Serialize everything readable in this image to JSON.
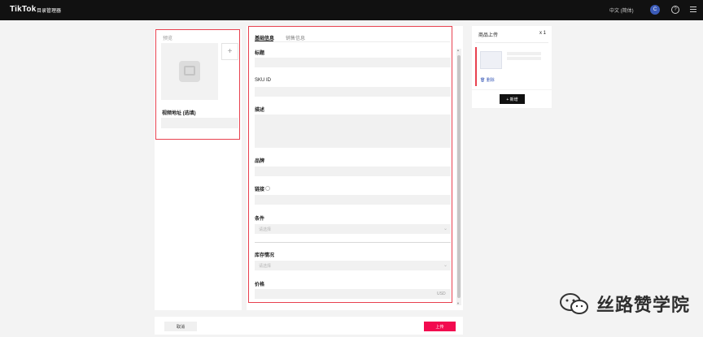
{
  "topbar": {
    "logo": "TikTok",
    "logo_sub": "目录管理器",
    "language": "中文 (简体)",
    "avatar_initial": "C"
  },
  "preview": {
    "title": "预览",
    "add_symbol": "+",
    "video_label": "视频地址 (选填)"
  },
  "form": {
    "tabs": [
      {
        "label": "基础信息",
        "active": true
      },
      {
        "label": "销售信息",
        "active": false
      }
    ],
    "fields": {
      "title_label": "标题",
      "sku_label": "SKU ID",
      "desc_label": "描述",
      "brand_label": "品牌",
      "link_label": "链接",
      "condition_label": "条件",
      "condition_placeholder": "请选择",
      "stock_label": "库存情况",
      "stock_placeholder": "请选择",
      "price_label": "价格",
      "price_unit": "USD"
    }
  },
  "upload": {
    "title": "商品上传",
    "count": "x 1",
    "delete_label": "删除",
    "add_label": "+ 新增"
  },
  "footer": {
    "cancel_label": "取消",
    "submit_label": "上传"
  },
  "watermark": {
    "text": "丝路赞学院"
  },
  "colors": {
    "accent": "#f20a4f",
    "highlight_border": "#e8414f",
    "avatar": "#3b5bb8"
  }
}
